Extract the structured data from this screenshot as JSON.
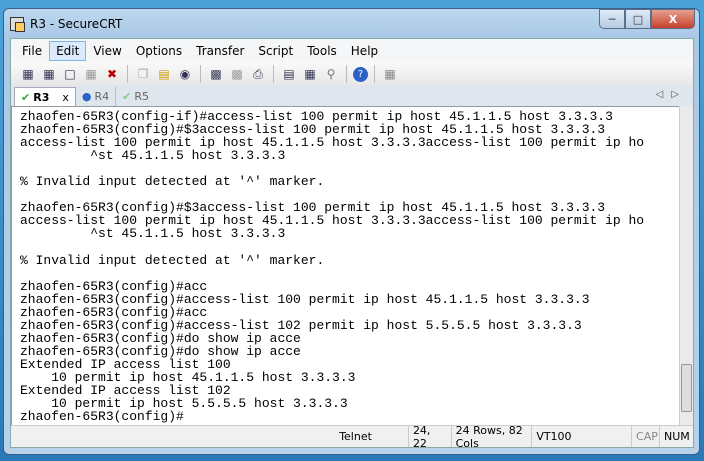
{
  "window": {
    "title": "R3 - SecureCRT"
  },
  "menu": [
    "File",
    "Edit",
    "View",
    "Options",
    "Transfer",
    "Script",
    "Tools",
    "Help"
  ],
  "toolbar_icons": [
    "connect-icon",
    "quick-connect-icon",
    "connect-tab-icon",
    "reconnect-icon",
    "disconnect-icon",
    "copy-icon",
    "paste-icon",
    "find-icon",
    "print-screen-icon",
    "print-selection-icon",
    "print-icon",
    "session-options-icon",
    "keymap-icon",
    "key-icon",
    "help-icon",
    "sftp-icon"
  ],
  "tabs": [
    {
      "label": "R3",
      "status": "connected",
      "active": true,
      "close": "x"
    },
    {
      "label": "R4",
      "status": "info"
    },
    {
      "label": "R5",
      "status": "connected"
    }
  ],
  "terminal_lines": [
    "zhaofen-65R3(config-if)#access-list 100 permit ip host 45.1.1.5 host 3.3.3.3",
    "zhaofen-65R3(config)#$3access-list 100 permit ip host 45.1.1.5 host 3.3.3.3",
    "access-list 100 permit ip host 45.1.1.5 host 3.3.3.3access-list 100 permit ip ho",
    "         ^st 45.1.1.5 host 3.3.3.3",
    "",
    "% Invalid input detected at '^' marker.",
    "",
    "zhaofen-65R3(config)#$3access-list 100 permit ip host 45.1.1.5 host 3.3.3.3",
    "access-list 100 permit ip host 45.1.1.5 host 3.3.3.3access-list 100 permit ip ho",
    "         ^st 45.1.1.5 host 3.3.3.3",
    "",
    "% Invalid input detected at '^' marker.",
    "",
    "zhaofen-65R3(config)#acc",
    "zhaofen-65R3(config)#access-list 100 permit ip host 45.1.1.5 host 3.3.3.3",
    "zhaofen-65R3(config)#acc",
    "zhaofen-65R3(config)#access-list 102 permit ip host 5.5.5.5 host 3.3.3.3",
    "zhaofen-65R3(config)#do show ip acce",
    "zhaofen-65R3(config)#do show ip acce",
    "Extended IP access list 100",
    "    10 permit ip host 45.1.1.5 host 3.3.3.3",
    "Extended IP access list 102",
    "    10 permit ip host 5.5.5.5 host 3.3.3.3",
    "zhaofen-65R3(config)#"
  ],
  "status": {
    "protocol": "Telnet",
    "cursor": "24, 22",
    "size": "24 Rows, 82 Cols",
    "emulation": "VT100",
    "cap": "CAP",
    "num": "NUM"
  }
}
